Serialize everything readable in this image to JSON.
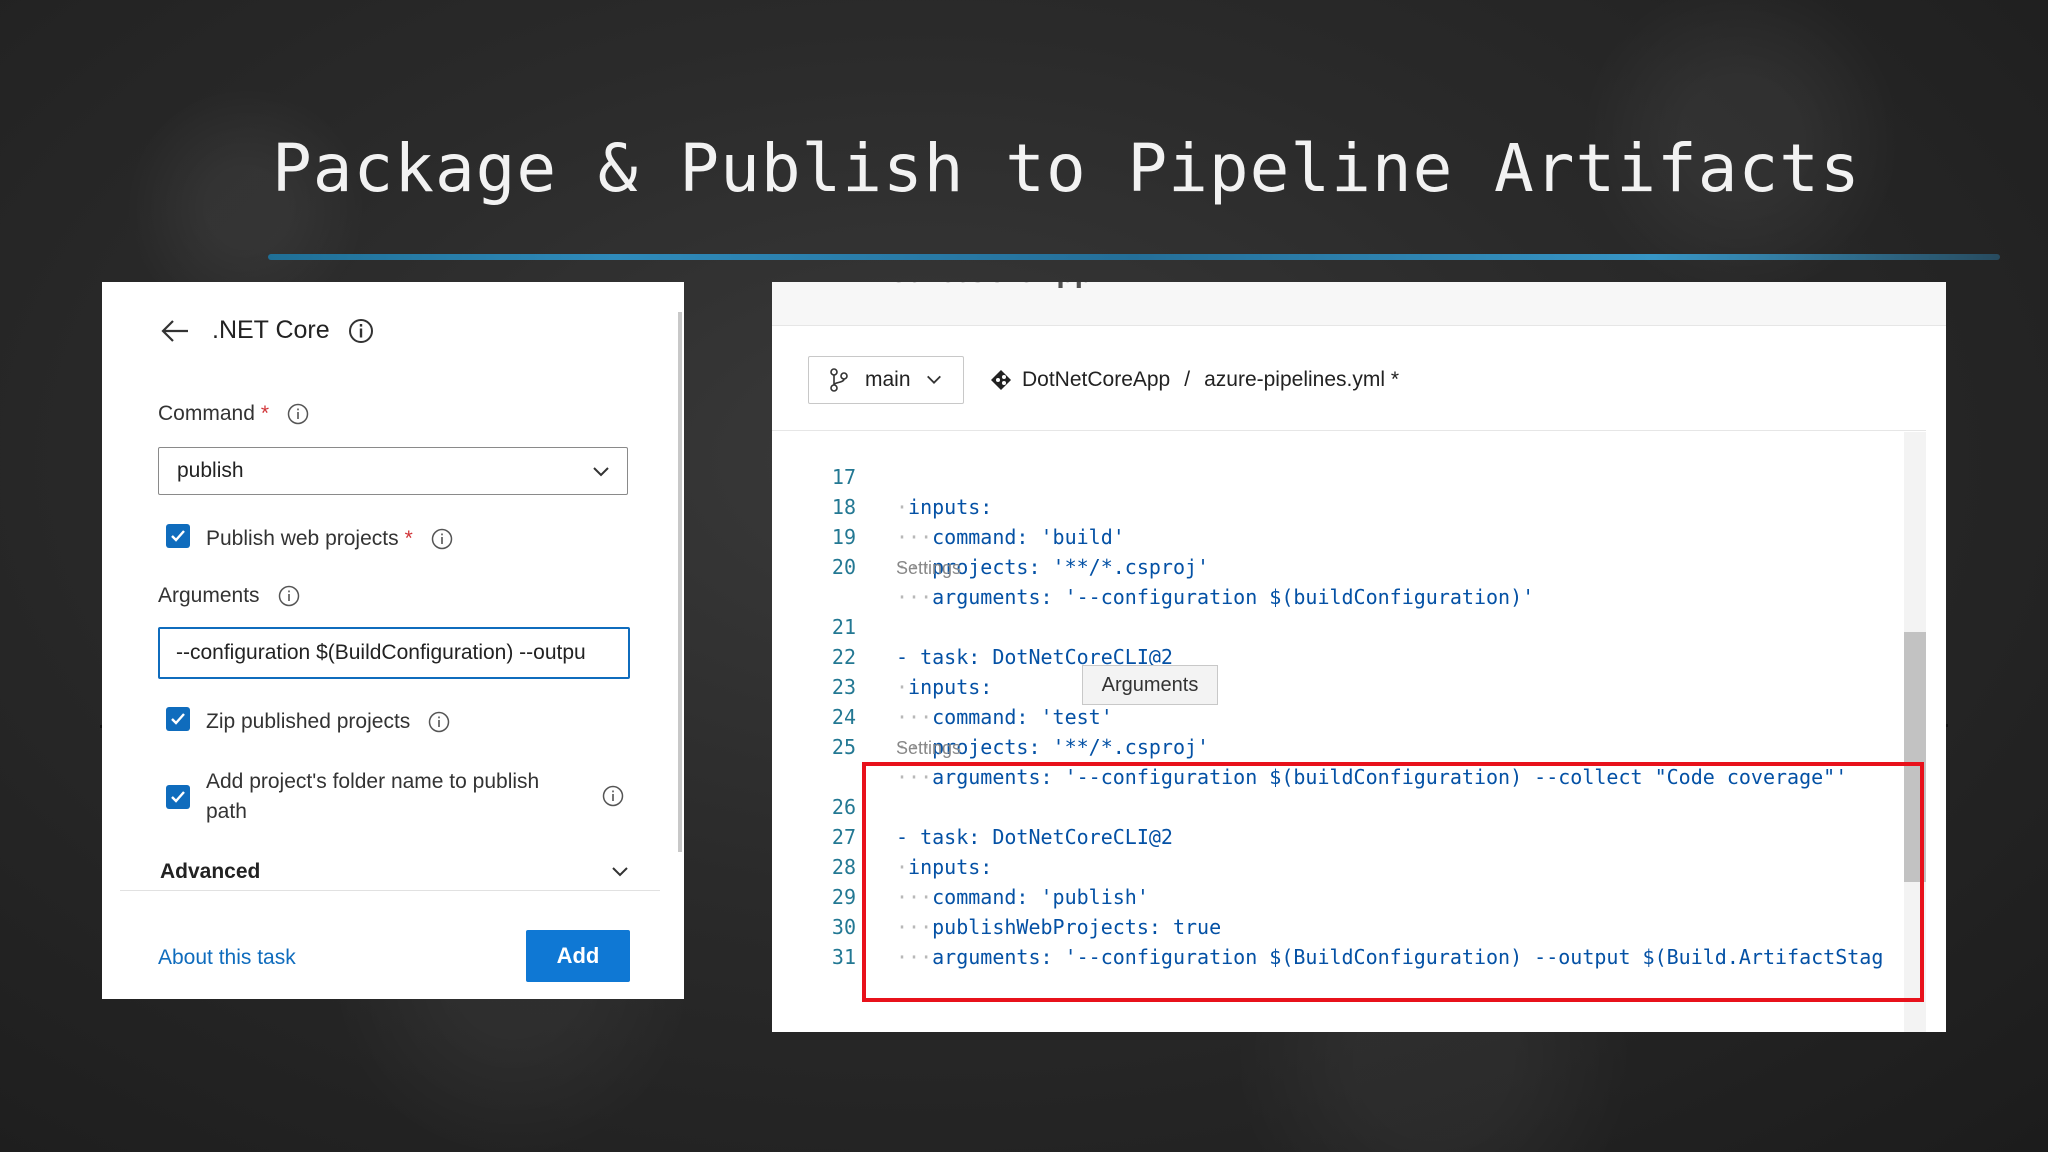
{
  "slide": {
    "title": "Package & Publish to Pipeline Artifacts"
  },
  "task_panel": {
    "title": ".NET Core",
    "command": {
      "label": "Command",
      "required_mark": "*",
      "value": "publish"
    },
    "publish_web": {
      "label": "Publish web projects",
      "required_mark": "*",
      "checked": true
    },
    "arguments": {
      "label": "Arguments",
      "value": "--configuration $(BuildConfiguration) --outpu"
    },
    "zip_published": {
      "label": "Zip published projects",
      "checked": true
    },
    "add_folder": {
      "label_line1": "Add project's folder name to publish",
      "label_line2": "path",
      "checked": true
    },
    "advanced_label": "Advanced",
    "about_link": "About this task",
    "add_button": "Add"
  },
  "editor": {
    "strip_text": "DotNetCoreApp",
    "branch": "main",
    "repo": "DotNetCoreApp",
    "separator": "/",
    "file": "azure-pipelines.yml *",
    "settings_label": "Settings",
    "tooltip": "Arguments",
    "lines": [
      {
        "n": "17",
        "text": "inputs:"
      },
      {
        "n": "18",
        "text": "command: 'build'"
      },
      {
        "n": "19",
        "text": "projects: '**/*.csproj'"
      },
      {
        "n": "20",
        "text": "arguments: '--configuration $(buildConfiguration)'"
      },
      {
        "n": "21",
        "text": "- task: DotNetCoreCLI@2"
      },
      {
        "n": "22",
        "text": "inputs:"
      },
      {
        "n": "23",
        "text": "command: 'test'"
      },
      {
        "n": "24",
        "text": "projects: '**/*.csproj'"
      },
      {
        "n": "25",
        "text": "arguments: '--configuration $(buildConfiguration) --collect \"Code coverage\"'"
      },
      {
        "n": "26",
        "text": "- task: DotNetCoreCLI@2"
      },
      {
        "n": "27",
        "text": "inputs:"
      },
      {
        "n": "28",
        "text": "command: 'publish'"
      },
      {
        "n": "29",
        "text": "publishWebProjects: true"
      },
      {
        "n": "30",
        "text": "arguments: '--configuration $(BuildConfiguration) --output $(Build.ArtifactStag"
      },
      {
        "n": "31",
        "text": ""
      }
    ]
  },
  "colors": {
    "accent_blue": "#0f78d4",
    "highlight_red": "#e8111b",
    "title_underline": "#2f8bbb"
  }
}
